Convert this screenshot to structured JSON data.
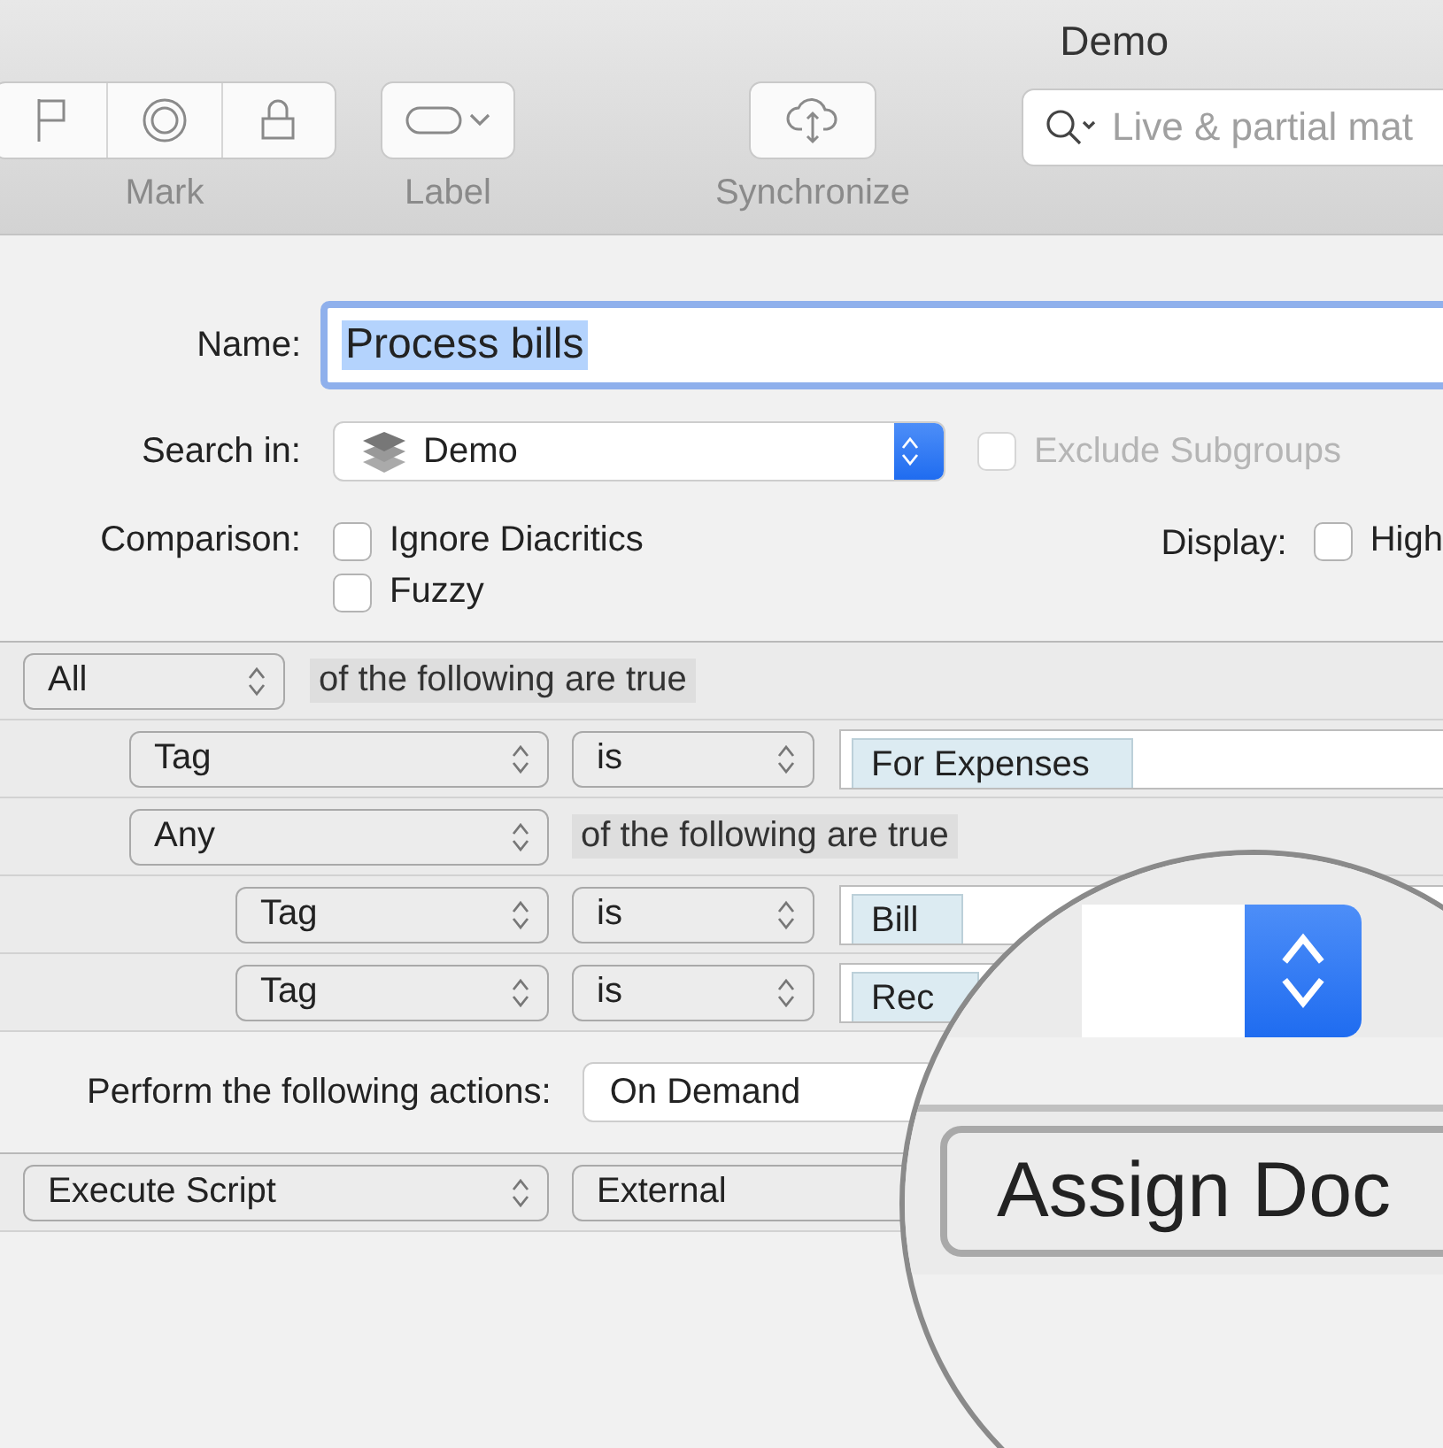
{
  "window": {
    "title": "Demo"
  },
  "toolbar": {
    "items": [
      {
        "kind": "segmented",
        "label": "Mark"
      },
      {
        "kind": "popup",
        "label": "Label"
      },
      {
        "kind": "button",
        "label": "Synchronize"
      }
    ],
    "search": {
      "placeholder": "Live & partial mat"
    }
  },
  "form": {
    "name_label": "Name:",
    "name_value": "Process bills",
    "name_selected": true,
    "search_in_label": "Search in:",
    "search_in_value": "Demo",
    "exclude": {
      "label": "Exclude Subgroups",
      "checked": false,
      "disabled": true
    },
    "comparison_label": "Comparison:",
    "comparison_options": [
      {
        "label": "Ignore Diacritics",
        "checked": false
      },
      {
        "label": "Fuzzy",
        "checked": false
      }
    ],
    "display_label": "Display:",
    "display_options": [
      {
        "label": "High",
        "checked": false
      }
    ]
  },
  "criteria": {
    "kind": "group",
    "quantifier": "All",
    "text": "of the following are true",
    "children": [
      {
        "kind": "condition",
        "field": "Tag",
        "operator": "is",
        "value": "For Expenses"
      },
      {
        "kind": "group",
        "quantifier": "Any",
        "text": "of the following are true",
        "children": [
          {
            "kind": "condition",
            "field": "Tag",
            "operator": "is",
            "value": "Bill"
          },
          {
            "kind": "condition",
            "field": "Tag",
            "operator": "is",
            "value": "Rec"
          }
        ]
      }
    ]
  },
  "actions": {
    "label": "Perform the following actions:",
    "trigger": "On Demand",
    "rows": [
      {
        "action": "Execute Script",
        "type": "External"
      }
    ]
  },
  "magnifier": {
    "button": "Assign Doc"
  }
}
